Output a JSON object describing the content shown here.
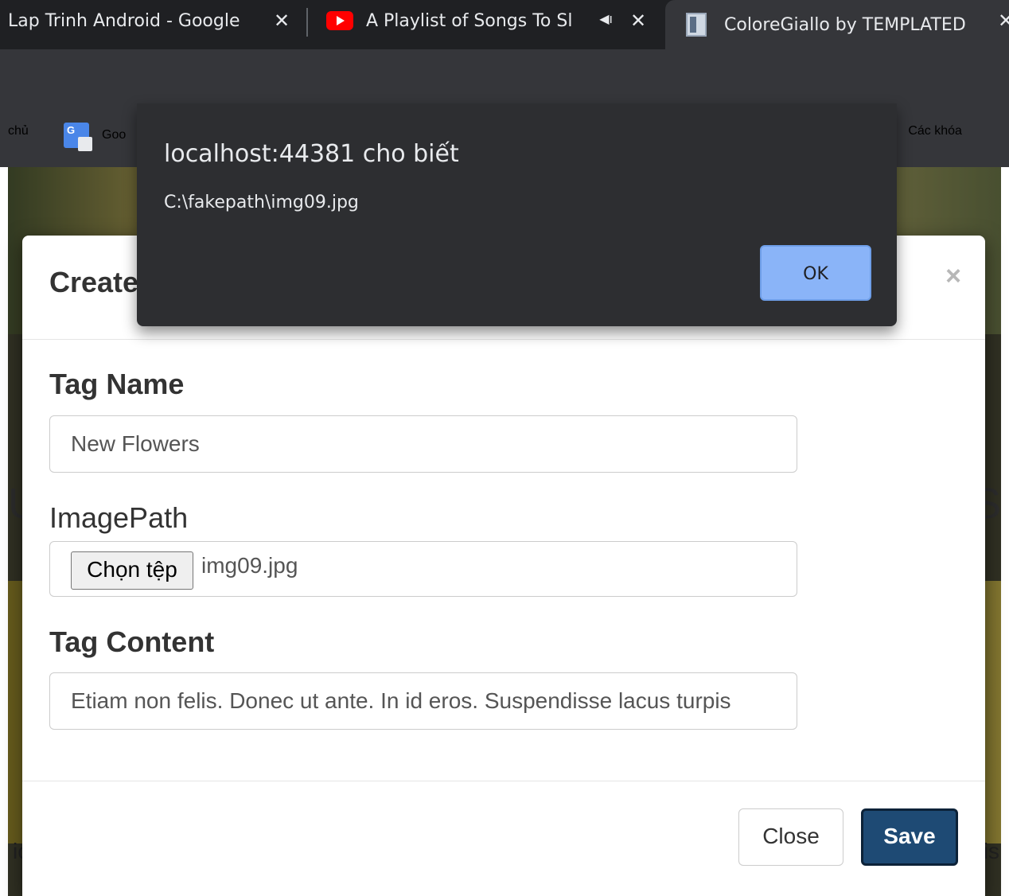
{
  "browser": {
    "tabs": [
      {
        "title": "Lap Trinh Android - Google"
      },
      {
        "title": "A Playlist of Songs To Sl"
      },
      {
        "title": "ColoreGiallo by TEMPLATED"
      }
    ],
    "bookmarks": [
      "chủ",
      "Goo",
      "Các khóa"
    ]
  },
  "page": {
    "left_char": "U",
    "right_char": "S",
    "left_text": "ic",
    "right_text": "is"
  },
  "modal": {
    "title": "Create",
    "close_symbol": "×",
    "fields": {
      "tag_name_label": "Tag Name",
      "tag_name_value": "New Flowers",
      "image_path_label": "ImagePath",
      "file_button": "Chọn tệp",
      "file_name": "img09.jpg",
      "tag_content_label": "Tag Content",
      "tag_content_value": "Etiam non felis. Donec ut ante. In id eros. Suspendisse lacus turpis"
    },
    "buttons": {
      "close": "Close",
      "save": "Save"
    },
    "colors": {
      "save_bg": "#1e4a74"
    }
  },
  "alert": {
    "title": "localhost:44381 cho biết",
    "message": "C:\\fakepath\\img09.jpg",
    "ok": "OK",
    "ok_color": "#8ab4f8"
  }
}
